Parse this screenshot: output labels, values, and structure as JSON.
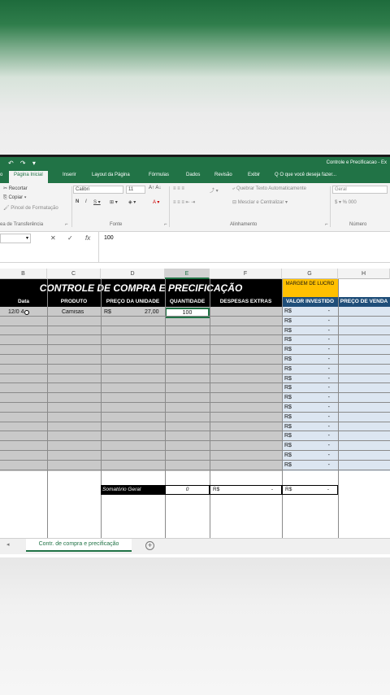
{
  "window": {
    "title": "Controle e Precificacao - Ex"
  },
  "tabs": [
    "o",
    "Página Inicial",
    "Inserir",
    "Layout da Página",
    "Fórmulas",
    "Dados",
    "Revisão",
    "Exibir",
    "Q O que você deseja fazer..."
  ],
  "ribbon": {
    "recortar": "Recortar",
    "copiar": "Copiar",
    "pincel": "Pincel de Formatação",
    "area_transferencia": "ea de Transferência",
    "font_name": "Calibri",
    "font_size": "11",
    "fonte_group": "Fonte",
    "quebrar_texto": "Quebrar Texto Automaticamente",
    "mesclar": "Mesclar e Centralizar",
    "alinhamento_group": "Alinhamento",
    "number_format": "Geral",
    "numero_group": "Número"
  },
  "formula_bar": {
    "value": "100",
    "fx": "fx"
  },
  "columns": [
    "B",
    "C",
    "D",
    "E",
    "F",
    "G",
    "H"
  ],
  "sheet": {
    "title": "CONTROLE DE COMPRA E PRECIFICAÇÃO",
    "margem": "MARGEM DE LUCRO",
    "headers": {
      "data": "Data",
      "produto": "PRODUTO",
      "preco_unidade": "PREÇO DA UNIDADE",
      "quantidade": "QUANTIDADE",
      "despesas": "DESPESAS EXTRAS",
      "valor_investido": "VALOR INVESTIDO",
      "preco_venda": "PREÇO DE VENDA"
    },
    "row1": {
      "data": "12/0 4",
      "produto": "Camisas",
      "currency": "R$",
      "preco": "27,00",
      "quantidade": "100"
    },
    "valor_rows": [
      "R$",
      "-"
    ],
    "summary": {
      "label": "Somatório Geral",
      "quantidade": "0",
      "despesas_currency": "R$",
      "despesas_value": "-",
      "valor_currency": "R$",
      "valor_value": "-"
    }
  },
  "sheet_tab": "Contr. de compra e precificação",
  "add_sheet": "+"
}
